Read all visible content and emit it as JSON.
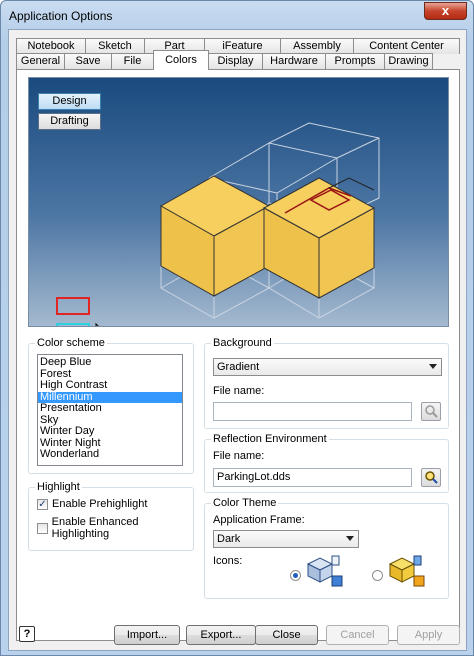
{
  "window": {
    "title": "Application Options",
    "close_glyph": "x"
  },
  "tabs": {
    "row1": [
      "Notebook",
      "Sketch",
      "Part",
      "iFeature",
      "Assembly",
      "Content Center"
    ],
    "row2": [
      "General",
      "Save",
      "File",
      "Colors",
      "Display",
      "Hardware",
      "Prompts",
      "Drawing"
    ],
    "active": "Colors"
  },
  "preview": {
    "design_label": "Design",
    "drafting_label": "Drafting",
    "cube_color": "#f0c14b"
  },
  "color_scheme": {
    "label": "Color scheme",
    "items": [
      "Deep Blue",
      "Forest",
      "High Contrast",
      "Millennium",
      "Presentation",
      "Sky",
      "Winter Day",
      "Winter Night",
      "Wonderland"
    ],
    "selected": "Millennium"
  },
  "highlight": {
    "label": "Highlight",
    "prehighlight": {
      "label": "Enable Prehighlight",
      "checked": true
    },
    "enhanced": {
      "label": "Enable Enhanced Highlighting",
      "checked": false
    }
  },
  "background": {
    "label": "Background",
    "selected": "Gradient",
    "file_label": "File name:",
    "file_value": ""
  },
  "reflection": {
    "label": "Reflection Environment",
    "file_label": "File name:",
    "file_value": "ParkingLot.dds"
  },
  "color_theme": {
    "label": "Color Theme",
    "frame_label": "Application Frame:",
    "frame_value": "Dark",
    "icons_label": "Icons:",
    "icons_selected": "first"
  },
  "buttons": {
    "help": "?",
    "import": "Import...",
    "export": "Export...",
    "close": "Close",
    "cancel": "Cancel",
    "apply": "Apply"
  }
}
